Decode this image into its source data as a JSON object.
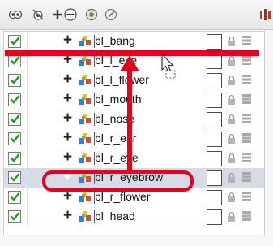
{
  "toolbar": {
    "icons": [
      "show-all-icon",
      "hide-all-icon",
      "add-layer-icon",
      "remove-layer-icon",
      "layer-properties-icon",
      "add-drawing-layer-icon"
    ],
    "right_icon": "columns-icon"
  },
  "layers": [
    {
      "name": "bl_bang",
      "checked": true,
      "selected": false
    },
    {
      "name": "bl_l_eye",
      "checked": true,
      "selected": false
    },
    {
      "name": "bl_l_flower",
      "checked": true,
      "selected": false
    },
    {
      "name": "bl_mouth",
      "checked": true,
      "selected": false
    },
    {
      "name": "bl_nose",
      "checked": true,
      "selected": false
    },
    {
      "name": "bl_r_ear",
      "checked": true,
      "selected": false
    },
    {
      "name": "bl_r_eye",
      "checked": true,
      "selected": false
    },
    {
      "name": "bl_r_eyebrow",
      "checked": true,
      "selected": true
    },
    {
      "name": "bl_r_flower",
      "checked": true,
      "selected": false
    },
    {
      "name": "bl_head",
      "checked": true,
      "selected": false
    }
  ],
  "colors": {
    "annotation_red": "#e5001e",
    "checkmark_green": "#1a9c1a",
    "selected_row": "#d6dbe6"
  }
}
